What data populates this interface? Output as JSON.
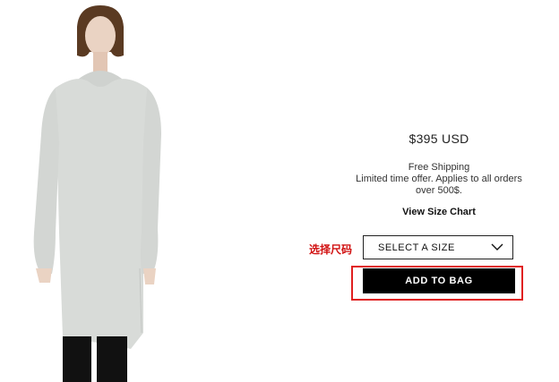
{
  "product": {
    "image_alt": "model wearing long grey hooded tunic",
    "price": "$395 USD",
    "shipping": {
      "line1": "Free Shipping",
      "line2": "Limited time offer. Applies to all orders",
      "line3": "over 500$."
    },
    "size_chart_link": "View Size Chart",
    "size_select": {
      "value": "SELECT A SIZE",
      "icon": "chevron-down-icon"
    },
    "add_to_bag": "ADD TO BAG"
  },
  "annotation": {
    "label": "选择尺码",
    "color": "#d11111",
    "highlight_color": "#e02020"
  }
}
